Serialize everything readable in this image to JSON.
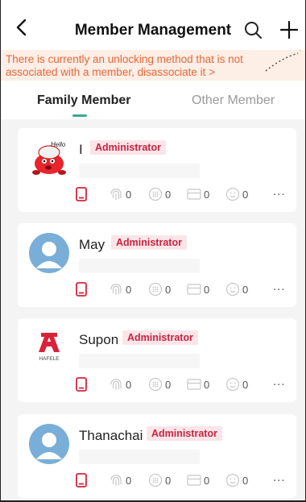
{
  "header": {
    "title": "Member Management"
  },
  "banner": {
    "text": "There is currently an unlocking method that is not associated with a member, disassociate it >"
  },
  "tabs": [
    {
      "label": "Family Member",
      "active": true
    },
    {
      "label": "Other Member",
      "active": false
    }
  ],
  "colors": {
    "accent": "#3aa98e",
    "banner_text": "#e6683a",
    "banner_bg": "#fdeee6",
    "badge_text": "#c8243f",
    "badge_bg": "#fbe5e9",
    "phone_icon": "#d9233a"
  },
  "members": [
    {
      "name": "I",
      "role": "Administrator",
      "avatar": "cartoon-mascot",
      "counts": {
        "fingerprint": "0",
        "password": "0",
        "card": "0",
        "face": "0"
      },
      "more": "..."
    },
    {
      "name": "May",
      "role": "Administrator",
      "avatar": "default-user",
      "counts": {
        "fingerprint": "0",
        "password": "0",
        "card": "0",
        "face": "0"
      },
      "more": "..."
    },
    {
      "name": "Supon",
      "role": "Administrator",
      "avatar": "hafele-logo",
      "avatar_text": "HAFELE",
      "counts": {
        "fingerprint": "0",
        "password": "0",
        "card": "0",
        "face": "0"
      },
      "more": "..."
    },
    {
      "name": "Thanachai",
      "role": "Administrator",
      "avatar": "default-user",
      "counts": {
        "fingerprint": "0",
        "password": "0",
        "card": "0",
        "face": "0"
      },
      "more": "..."
    }
  ],
  "icons": {
    "back": "chevron-left-icon",
    "search": "search-icon",
    "add": "plus-icon",
    "phone": "phone-icon",
    "fingerprint": "fingerprint-icon",
    "password": "password-icon",
    "card": "card-icon",
    "face": "face-icon"
  }
}
